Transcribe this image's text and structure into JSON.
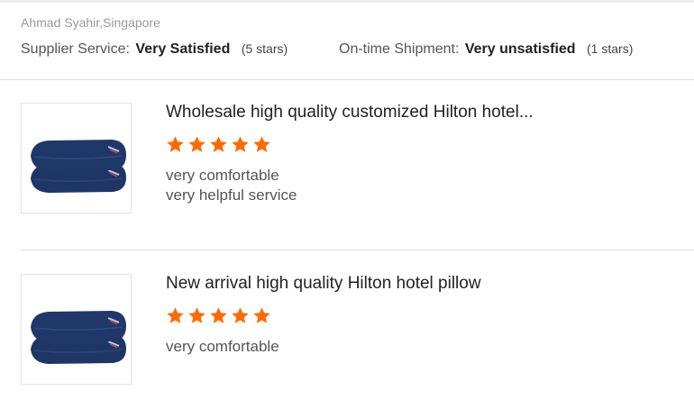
{
  "reviewer": "Ahmad Syahir,Singapore",
  "ratings": [
    {
      "label": "Supplier Service:",
      "value": "Very Satisfied",
      "stars": "(5 stars)"
    },
    {
      "label": "On-time Shipment:",
      "value": "Very unsatisfied",
      "stars": "(1 stars)"
    }
  ],
  "colors": {
    "star": "#ff6a00",
    "pillow": "#1f3566"
  },
  "products": [
    {
      "title": "Wholesale high quality customized Hilton hotel...",
      "rating": 5,
      "comments": [
        "very comfortable",
        "very helpful service"
      ]
    },
    {
      "title": "New arrival high quality Hilton hotel pillow",
      "rating": 5,
      "comments": [
        "very comfortable"
      ]
    }
  ]
}
